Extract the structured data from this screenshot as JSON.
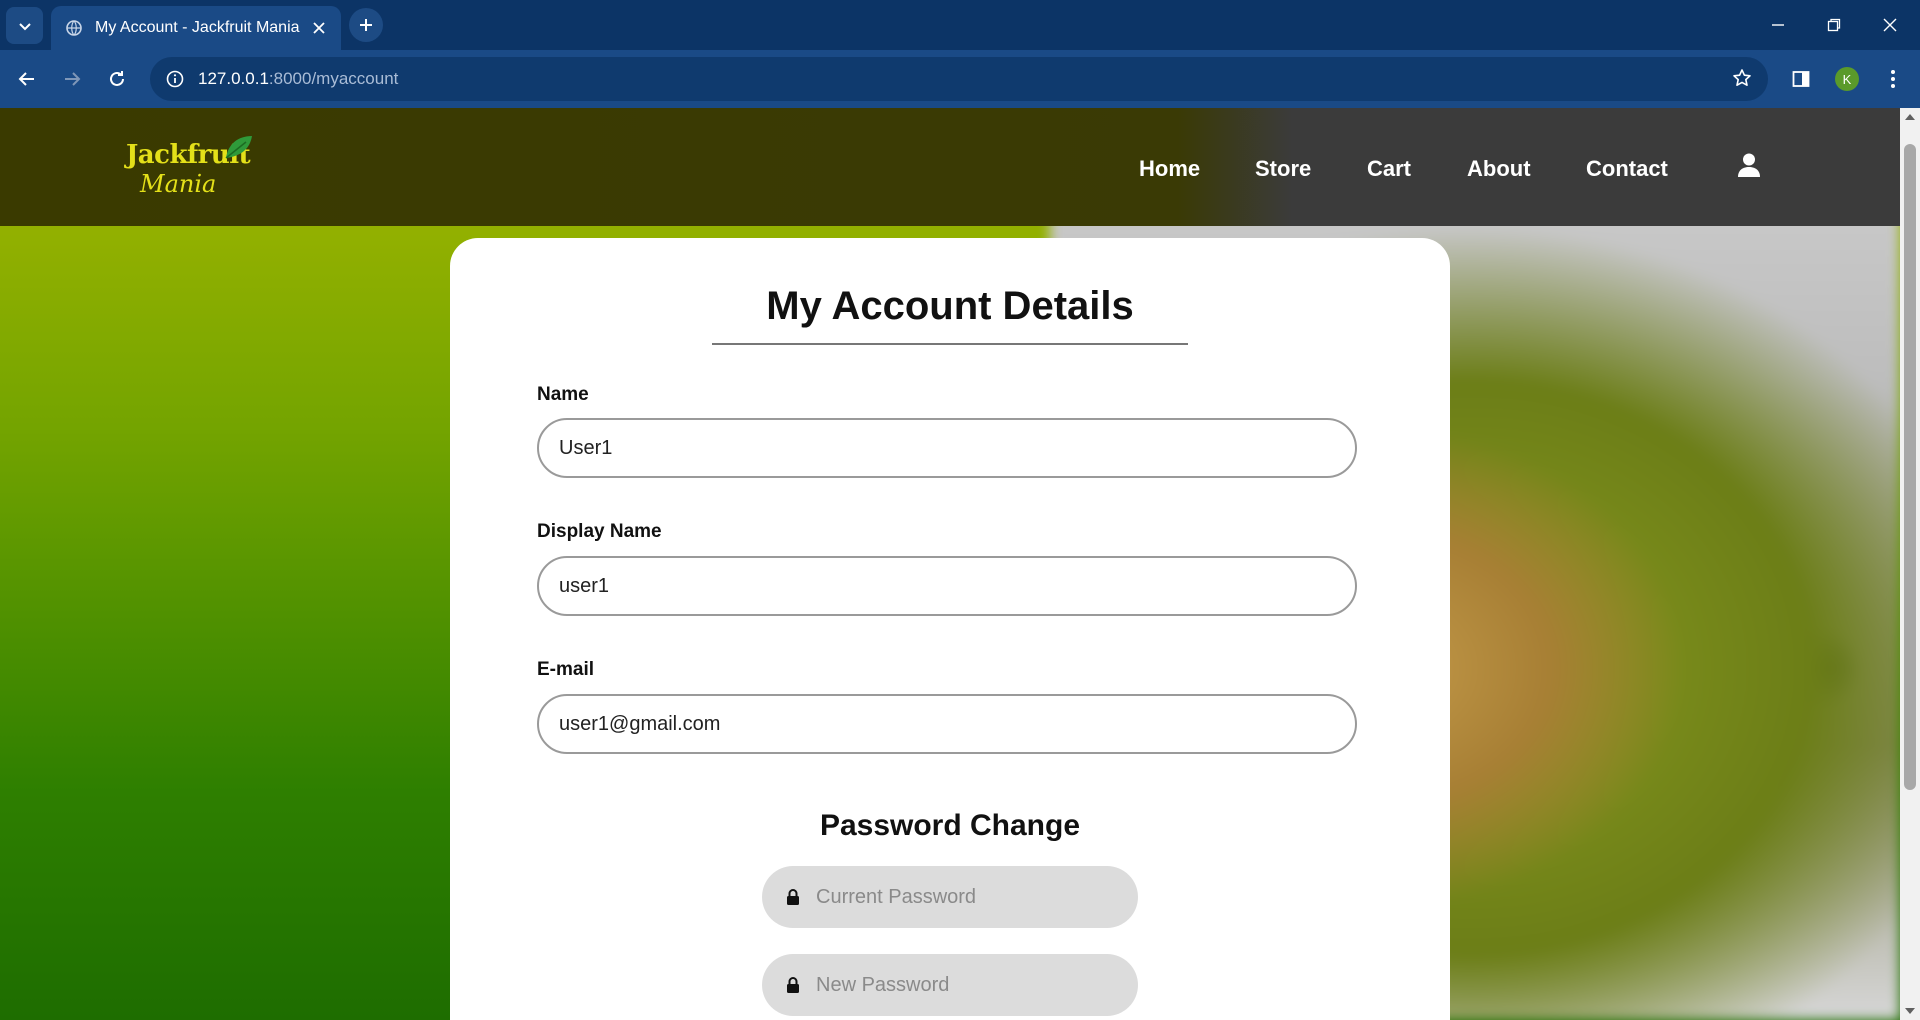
{
  "browser": {
    "tab_title": "My Account - Jackfruit Mania",
    "url_host": "127.0.0.1",
    "url_path": ":8000/myaccount",
    "profile_initial": "K"
  },
  "site": {
    "logo_line1": "Jackfruit",
    "logo_line2": "Mania",
    "nav": [
      "Home",
      "Store",
      "Cart",
      "About",
      "Contact"
    ]
  },
  "account": {
    "heading": "My Account Details",
    "name_label": "Name",
    "name_value": "User1",
    "display_label": "Display Name",
    "display_value": "user1",
    "email_label": "E-mail",
    "email_value": "user1@gmail.com",
    "password_heading": "Password Change",
    "current_password_placeholder": "Current Password",
    "new_password_placeholder": "New Password"
  }
}
